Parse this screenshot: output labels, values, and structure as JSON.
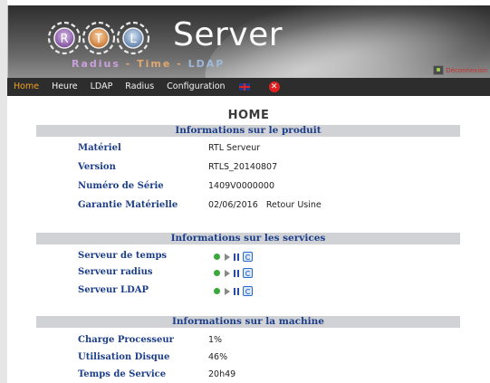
{
  "header": {
    "logo_letters": [
      "R",
      "T",
      "L"
    ],
    "logo_word": "Server",
    "logo_sub_parts": [
      "Radius",
      " - Time - ",
      "LDAP"
    ],
    "logout_label": "Déconnexion"
  },
  "nav": {
    "items": [
      {
        "label": "Home",
        "active": true
      },
      {
        "label": "Heure",
        "active": false
      },
      {
        "label": "LDAP",
        "active": false
      },
      {
        "label": "Radius",
        "active": false
      },
      {
        "label": "Configuration",
        "active": false
      }
    ],
    "flag_icon": "uk-flag-icon",
    "close_icon": "close-icon",
    "close_glyph": "✕"
  },
  "page": {
    "title": "HOME"
  },
  "sections": {
    "product": {
      "heading": "Informations sur le produit",
      "rows": [
        {
          "label": "Matériel",
          "value": "RTL Serveur"
        },
        {
          "label": "Version",
          "value": "RTLS_20140807"
        },
        {
          "label": "Numéro de Série",
          "value": "1409V0000000"
        },
        {
          "label": "Garantie Matérielle",
          "value": "02/06/2016   Retour Usine"
        }
      ]
    },
    "services": {
      "heading": "Informations sur les services",
      "rows": [
        {
          "label": "Serveur de temps",
          "status": "running"
        },
        {
          "label": "Serveur radius",
          "status": "running"
        },
        {
          "label": "Serveur LDAP",
          "status": "running"
        }
      ],
      "icons": [
        "status-dot-icon",
        "play-icon",
        "pause-icon",
        "restart-icon"
      ]
    },
    "machine": {
      "heading": "Informations sur la machine",
      "rows": [
        {
          "label": "Charge Processeur",
          "value": "1%"
        },
        {
          "label": "Utilisation Disque",
          "value": "46%"
        },
        {
          "label": "Temps de Service",
          "value": "20h49"
        }
      ]
    }
  },
  "colors": {
    "accent": "#f0a020",
    "label_blue": "#1c3e88",
    "section_bg": "#d0d2d6",
    "nav_bg": "#2d2d2d",
    "status_green": "#3aa83a"
  }
}
